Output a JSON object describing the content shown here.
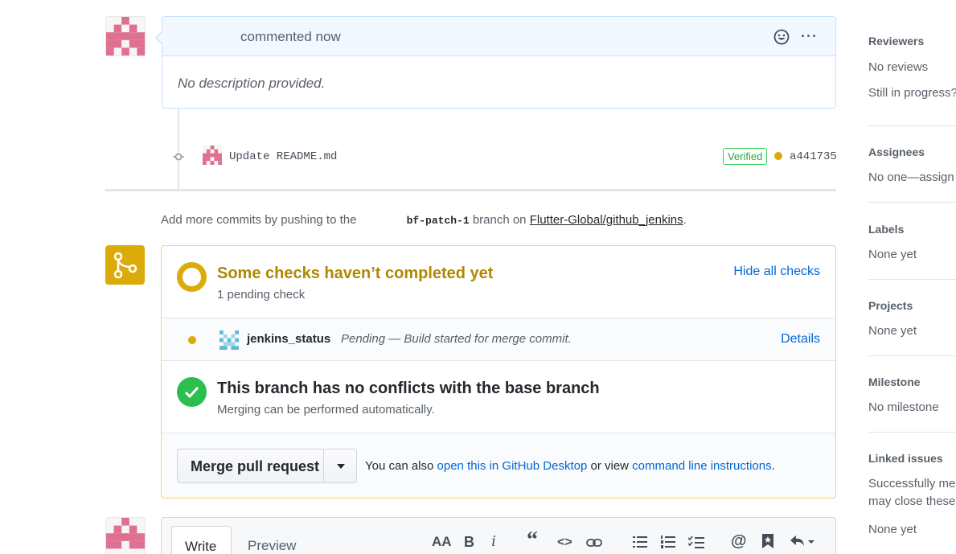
{
  "comment": {
    "meta": "commented now",
    "body": "No description provided.",
    "more": "···"
  },
  "commit": {
    "message": "Update README.md",
    "verified": "Verified",
    "sha": "a441735"
  },
  "push_hint": {
    "prefix": "Add more commits by pushing to the",
    "branch": "bf-patch-1",
    "middle": "branch on",
    "repo": "Flutter-Global/github_jenkins",
    "suffix": "."
  },
  "checks": {
    "title": "Some checks haven’t completed yet",
    "subtitle": "1 pending check",
    "toggle": "Hide all checks",
    "items": [
      {
        "name": "jenkins_status",
        "description": "Pending — Build started for merge commit.",
        "link": "Details"
      }
    ]
  },
  "conflicts": {
    "title": "This branch has no conflicts with the base branch",
    "subtitle": "Merging can be performed automatically."
  },
  "merge": {
    "button": "Merge pull request",
    "also_prefix": "You can also",
    "desktop_link": "open this in GitHub Desktop",
    "or_view": "or view",
    "cli_link": "command line instructions",
    "suffix": "."
  },
  "editor": {
    "tab_write": "Write",
    "tab_preview": "Preview",
    "toolbar": {
      "heading": "AA",
      "bold": "B",
      "italic": "i",
      "quote": "“",
      "code": "<>"
    }
  },
  "sidebar": {
    "reviewers": {
      "heading": "Reviewers",
      "values": [
        "No reviews",
        "Still in progress?"
      ]
    },
    "assignees": {
      "heading": "Assignees",
      "values": [
        "No one—assign"
      ]
    },
    "labels": {
      "heading": "Labels",
      "values": [
        "None yet"
      ]
    },
    "projects": {
      "heading": "Projects",
      "values": [
        "None yet"
      ]
    },
    "milestone": {
      "heading": "Milestone",
      "values": [
        "No milestone"
      ]
    },
    "linked_issues": {
      "heading": "Linked issues",
      "values": [
        "Successfully mer",
        "may close these",
        "None yet"
      ]
    }
  },
  "colors": {
    "pending": "#dbab09",
    "success": "#2cbe4e",
    "link": "#0366d6",
    "identicon": "#e07090"
  }
}
